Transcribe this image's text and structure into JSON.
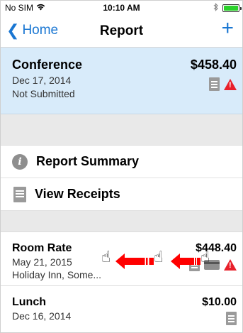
{
  "status_bar": {
    "carrier": "No SIM",
    "time": "10:10 AM"
  },
  "nav": {
    "back_label": "Home",
    "title": "Report",
    "add_label": "+"
  },
  "report": {
    "name": "Conference",
    "amount": "$458.40",
    "date": "Dec 17, 2014",
    "status": "Not Submitted"
  },
  "menu": [
    {
      "label": "Report Summary",
      "icon": "info-icon"
    },
    {
      "label": "View Receipts",
      "icon": "receipt-icon"
    }
  ],
  "expenses": [
    {
      "name": "Room Rate",
      "amount": "$448.40",
      "date": "May 21, 2015",
      "vendor": "Holiday Inn, Some..."
    },
    {
      "name": "Lunch",
      "amount": "$10.00",
      "date": "Dec 16, 2014"
    }
  ],
  "colors": {
    "accent": "#1976d2",
    "selected_bg": "#d8ebfa",
    "warning": "#e8202a",
    "gesture_arrow": "#ff0000"
  }
}
